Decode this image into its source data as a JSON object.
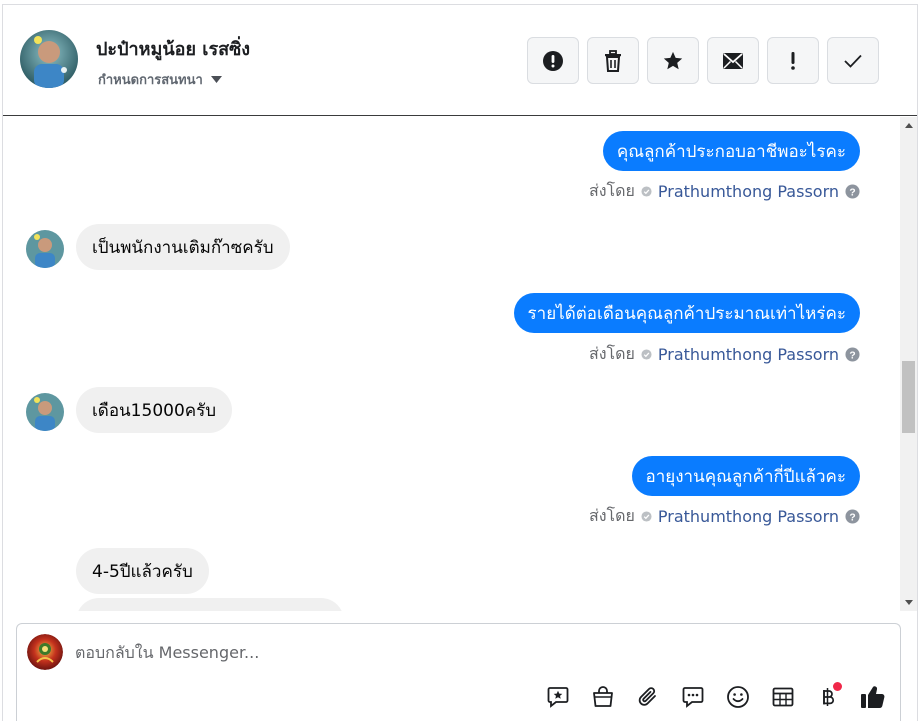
{
  "header": {
    "contact_name": "ปะป๋าหมูน้อย เรสซิ่ง",
    "settings_label": "กำหนดการสนทนา",
    "icons": [
      "alert-circle-icon",
      "trash-icon",
      "star-icon",
      "mail-icon",
      "exclamation-icon",
      "check-icon"
    ]
  },
  "conversation": {
    "messages": [
      {
        "direction": "out",
        "text": "คุณลูกค้าประกอบอาชีพอะไรคะ",
        "sent_by_label": "ส่งโดย",
        "sender": "Prathumthong Passorn"
      },
      {
        "direction": "in",
        "text": "เป็นพนักงานเติมก๊าซครับ"
      },
      {
        "direction": "out",
        "text": "รายได้ต่อเดือนคุณลูกค้าประมาณเท่าไหร่คะ",
        "sent_by_label": "ส่งโดย",
        "sender": "Prathumthong Passorn"
      },
      {
        "direction": "in",
        "text": "เดือน15000ครับ"
      },
      {
        "direction": "out",
        "text": "อายุงานคุณลูกค้ากี่ปีแล้วคะ",
        "sent_by_label": "ส่งโดย",
        "sender": "Prathumthong Passorn"
      },
      {
        "direction": "in",
        "text": "4-5ปีแล้วครับ"
      }
    ]
  },
  "composer": {
    "placeholder": "ตอบกลับใน Messenger...",
    "icons": [
      "saved-reply-icon",
      "shop-bag-icon",
      "attachment-icon",
      "chat-bubble-icon",
      "emoji-icon",
      "calendar-icon",
      "baht-payment-icon",
      "like-icon"
    ]
  },
  "colors": {
    "outgoing_bubble": "#0a7cff",
    "incoming_bubble": "#f0f0f0",
    "sender_link": "#385898",
    "notification_dot": "#f02849"
  }
}
